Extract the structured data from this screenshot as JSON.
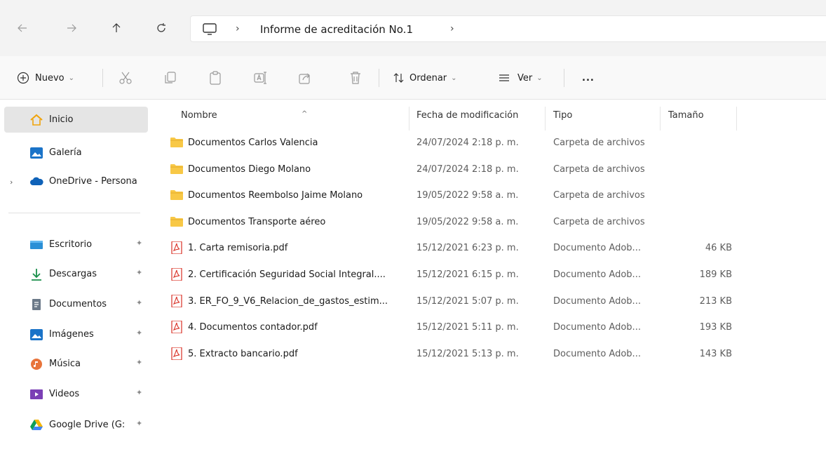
{
  "breadcrumb": {
    "location": "Informe de acreditación No.1"
  },
  "toolbar": {
    "new_label": "Nuevo",
    "sort_label": "Ordenar",
    "view_label": "Ver",
    "more_label": "..."
  },
  "sidebar": {
    "items": [
      {
        "label": "Inicio",
        "icon": "home-icon"
      },
      {
        "label": "Galería",
        "icon": "gallery-icon"
      },
      {
        "label": "OneDrive - Persona",
        "icon": "onedrive-icon"
      },
      {
        "label": "Escritorio",
        "icon": "desktop-icon"
      },
      {
        "label": "Descargas",
        "icon": "download-icon"
      },
      {
        "label": "Documentos",
        "icon": "documents-icon"
      },
      {
        "label": "Imágenes",
        "icon": "pictures-icon"
      },
      {
        "label": "Música",
        "icon": "music-icon"
      },
      {
        "label": "Videos",
        "icon": "videos-icon"
      },
      {
        "label": "Google Drive (G:",
        "icon": "google-drive-icon"
      }
    ]
  },
  "columns": {
    "name": "Nombre",
    "date": "Fecha de modificación",
    "type": "Tipo",
    "size": "Tamaño"
  },
  "files": [
    {
      "name": "Documentos Carlos Valencia",
      "date": "24/07/2024 2:18 p. m.",
      "type": "Carpeta de archivos",
      "size": "",
      "kind": "folder"
    },
    {
      "name": "Documentos Diego Molano",
      "date": "24/07/2024 2:18 p. m.",
      "type": "Carpeta de archivos",
      "size": "",
      "kind": "folder"
    },
    {
      "name": "Documentos Reembolso Jaime Molano",
      "date": "19/05/2022 9:58 a. m.",
      "type": "Carpeta de archivos",
      "size": "",
      "kind": "folder"
    },
    {
      "name": "Documentos Transporte aéreo",
      "date": "19/05/2022 9:58 a. m.",
      "type": "Carpeta de archivos",
      "size": "",
      "kind": "folder"
    },
    {
      "name": "1. Carta remisoria.pdf",
      "date": "15/12/2021 6:23 p. m.",
      "type": "Documento Adob...",
      "size": "46 KB",
      "kind": "pdf"
    },
    {
      "name": "2. Certificación Seguridad Social Integral....",
      "date": "15/12/2021 6:15 p. m.",
      "type": "Documento Adob...",
      "size": "189 KB",
      "kind": "pdf"
    },
    {
      "name": "3. ER_FO_9_V6_Relacion_de_gastos_estim...",
      "date": "15/12/2021 5:07 p. m.",
      "type": "Documento Adob...",
      "size": "213 KB",
      "kind": "pdf"
    },
    {
      "name": "4. Documentos contador.pdf",
      "date": "15/12/2021 5:11 p. m.",
      "type": "Documento Adob...",
      "size": "193 KB",
      "kind": "pdf"
    },
    {
      "name": "5. Extracto bancario.pdf",
      "date": "15/12/2021 5:13 p. m.",
      "type": "Documento Adob...",
      "size": "143 KB",
      "kind": "pdf"
    }
  ],
  "colors": {
    "folder": "#f8c846",
    "pdf": "#d93025",
    "accent": "#0067c0"
  }
}
